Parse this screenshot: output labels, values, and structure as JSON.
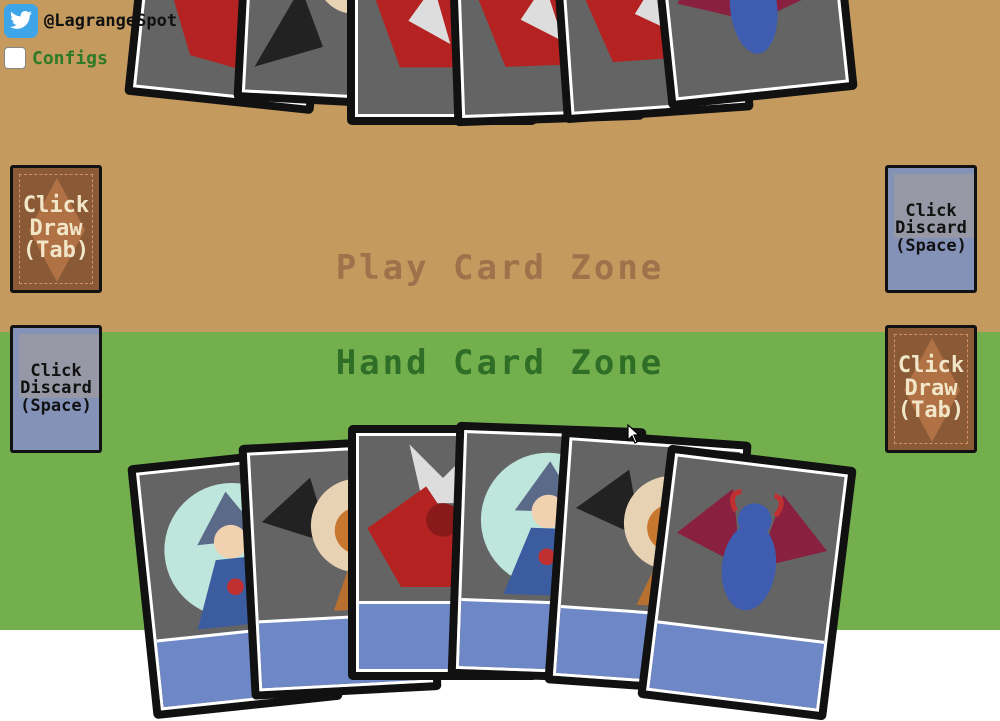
{
  "header": {
    "twitter_handle": "@LagrangeSpot",
    "configs_label": "Configs",
    "configs_checked": false
  },
  "zones": {
    "play": "Play Card Zone",
    "hand": "Hand Card Zone"
  },
  "opponent_piles": {
    "draw": "Click\nDraw\n(Tab)",
    "discard": "Click\nDiscard\n(Space)"
  },
  "player_piles": {
    "discard": "Click\nDiscard\n(Space)",
    "draw": "Click\nDraw\n(Tab)"
  },
  "opponent_hand": [
    "red-dragon-card",
    "lion-dragon-card",
    "red-dragon-card",
    "red-dragon-card",
    "red-dragon-card",
    "blue-demon-card"
  ],
  "player_hand": [
    "wizard-card",
    "lion-dragon-card",
    "red-dragon-card",
    "wizard-card",
    "lion-dragon-card",
    "blue-demon-card"
  ],
  "colors": {
    "play_zone": "#c49a5e",
    "hand_zone": "#73b04d",
    "card_strip": "#6e87c7"
  }
}
